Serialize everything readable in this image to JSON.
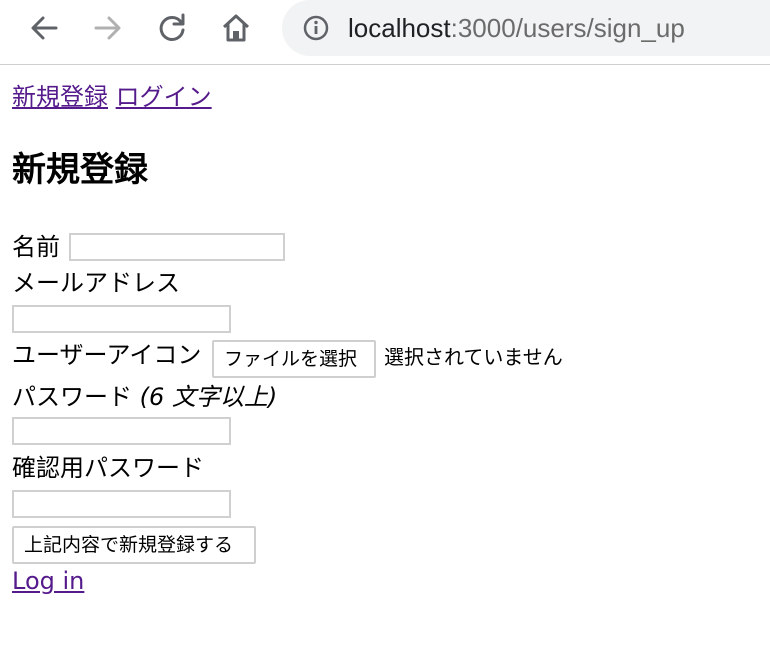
{
  "browser": {
    "url_host": "localhost",
    "url_path": ":3000/users/sign_up"
  },
  "nav": {
    "signup_link": "新規登録",
    "login_link": "ログイン"
  },
  "page_title": "新規登録",
  "form": {
    "name_label": "名前",
    "email_label": "メールアドレス",
    "icon_label": "ユーザーアイコン",
    "file_button": "ファイルを選択",
    "file_status": "選択されていません",
    "password_label": "パスワード",
    "password_hint": "(6 文字以上)",
    "password_confirm_label": "確認用パスワード",
    "submit_button": "上記内容で新規登録する"
  },
  "footer_link": "Log in",
  "colors": {
    "link": "#551a8b",
    "omnibox_bg": "#f1f3f4",
    "disabled_icon": "#b0b0b0"
  }
}
